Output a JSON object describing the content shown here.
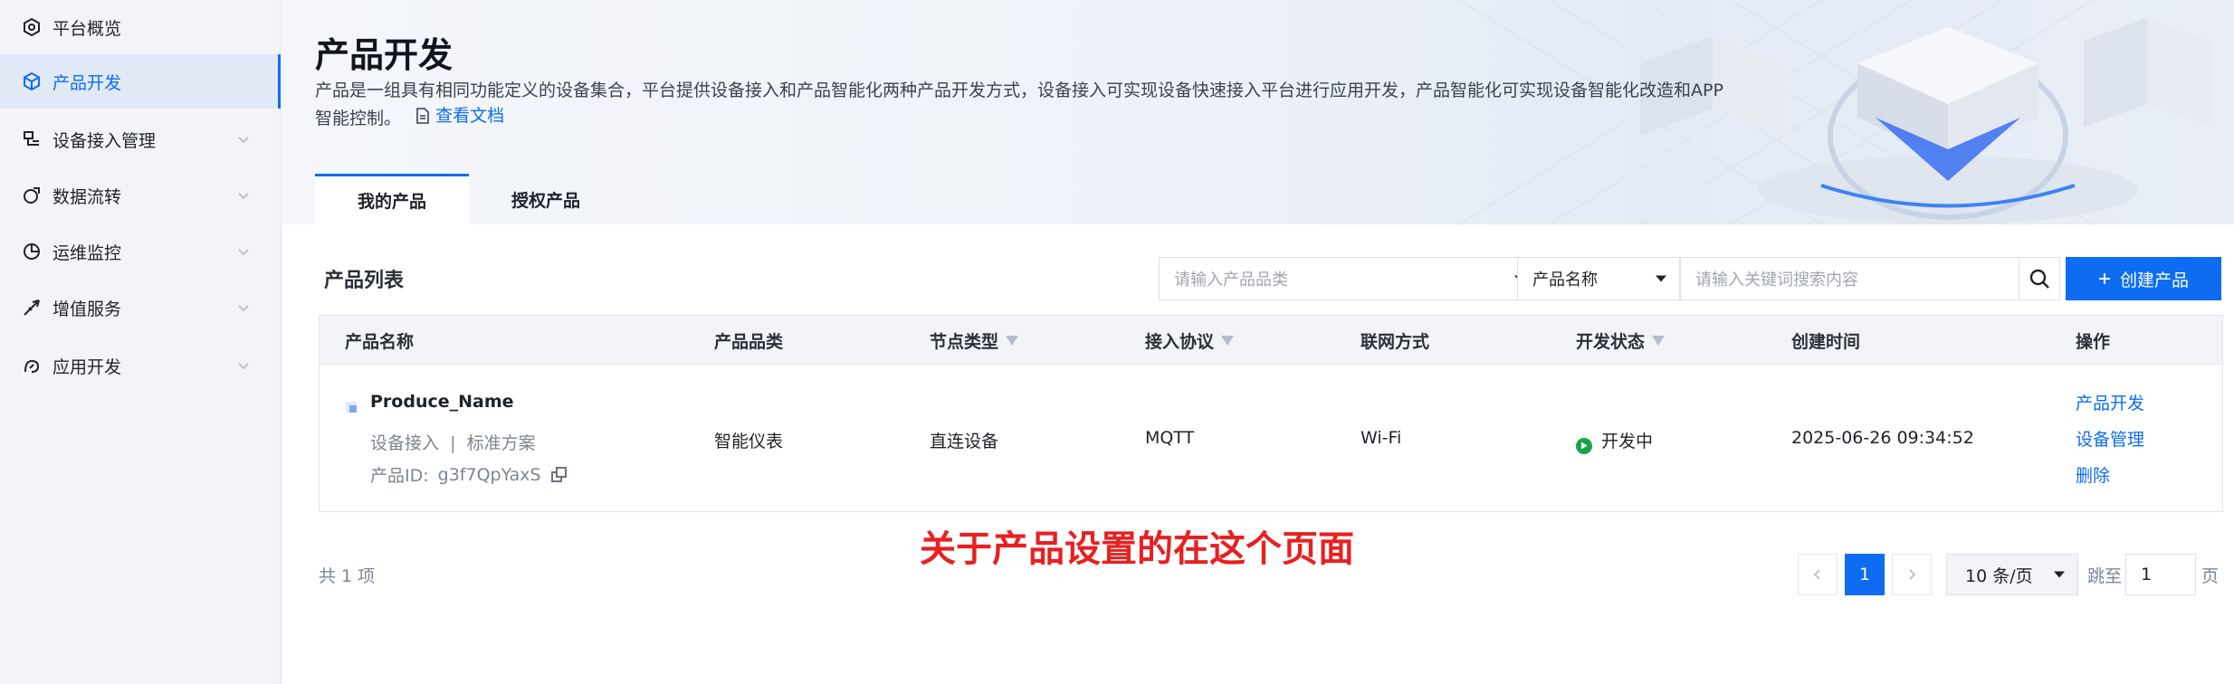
{
  "sidebar": {
    "items": [
      {
        "label": "平台概览",
        "icon": "overview-icon",
        "active": false,
        "chevron": false
      },
      {
        "label": "产品开发",
        "icon": "cube-icon",
        "active": true,
        "chevron": false
      },
      {
        "label": "设备接入管理",
        "icon": "device-access-icon",
        "active": false,
        "chevron": true
      },
      {
        "label": "数据流转",
        "icon": "data-flow-icon",
        "active": false,
        "chevron": true
      },
      {
        "label": "运维监控",
        "icon": "monitor-icon",
        "active": false,
        "chevron": true
      },
      {
        "label": "增值服务",
        "icon": "rocket-icon",
        "active": false,
        "chevron": true
      },
      {
        "label": "应用开发",
        "icon": "app-dev-icon",
        "active": false,
        "chevron": true
      }
    ]
  },
  "header": {
    "title": "产品开发",
    "description": "产品是一组具有相同功能定义的设备集合，平台提供设备接入和产品智能化两种产品开发方式，设备接入可实现设备快速接入平台进行应用开发，产品智能化可实现设备智能化改造和APP智能控制。",
    "doc_link": "查看文档"
  },
  "tabs": [
    {
      "label": "我的产品",
      "active": true
    },
    {
      "label": "授权产品",
      "active": false
    }
  ],
  "list": {
    "title": "产品列表",
    "category_placeholder": "请输入产品品类",
    "search_field": "产品名称",
    "keyword_placeholder": "请输入关键词搜索内容",
    "create_label": "创建产品"
  },
  "table": {
    "columns": [
      "产品名称",
      "产品品类",
      "节点类型",
      "接入协议",
      "联网方式",
      "开发状态",
      "创建时间",
      "操作"
    ],
    "rows": [
      {
        "name": "Produce_Name",
        "access": "设备接入",
        "sep": "|",
        "scheme": "标准方案",
        "id_label": "产品ID:",
        "id": "g3f7QpYaxS",
        "category": "智能仪表",
        "node_type": "直连设备",
        "protocol": "MQTT",
        "network": "Wi-Fi",
        "status": "开发中",
        "created": "2025-06-26 09:34:52",
        "ops": [
          "产品开发",
          "设备管理",
          "删除"
        ]
      }
    ]
  },
  "annotation": "关于产品设置的在这个页面",
  "pagination": {
    "total": "共 1 项",
    "current_page": "1",
    "page_size": "10 条/页",
    "jump_label": "跳至",
    "jump_value": "1",
    "page_unit": "页"
  },
  "colors": {
    "accent": "#0d6cf2",
    "status_green": "#1aa34a",
    "annotation_red": "#e82020"
  }
}
